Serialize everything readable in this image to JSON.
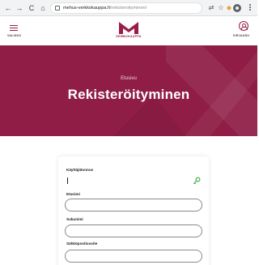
{
  "browser": {
    "url_host": "mehus-verkkokauppa.fi",
    "url_path": "/rekisteroityminen/"
  },
  "header": {
    "menu_label": "VALIKKO",
    "logo_text": "SEMBOKAUPPA",
    "login_label": "KIRJAUDU"
  },
  "hero": {
    "breadcrumb": "Etusivu",
    "title": "Rekisteröityminen"
  },
  "form": {
    "username_label": "Käyttäjätunnus",
    "firstname_label": "Etunimi",
    "lastname_label": "Sukunimi",
    "email_label": "Sähköpostiosoite"
  },
  "colors": {
    "brand": "#8f1d45",
    "hero_bg": "#8f1d45"
  },
  "icons": [
    "back-icon",
    "forward-icon",
    "reload-icon",
    "home-icon",
    "site-info-icon",
    "translate-icon",
    "bookmark-star-icon",
    "extensions-icon",
    "profile-icon",
    "menu-dots-icon",
    "hamburger-icon",
    "logo-icon",
    "user-icon",
    "key-icon"
  ]
}
